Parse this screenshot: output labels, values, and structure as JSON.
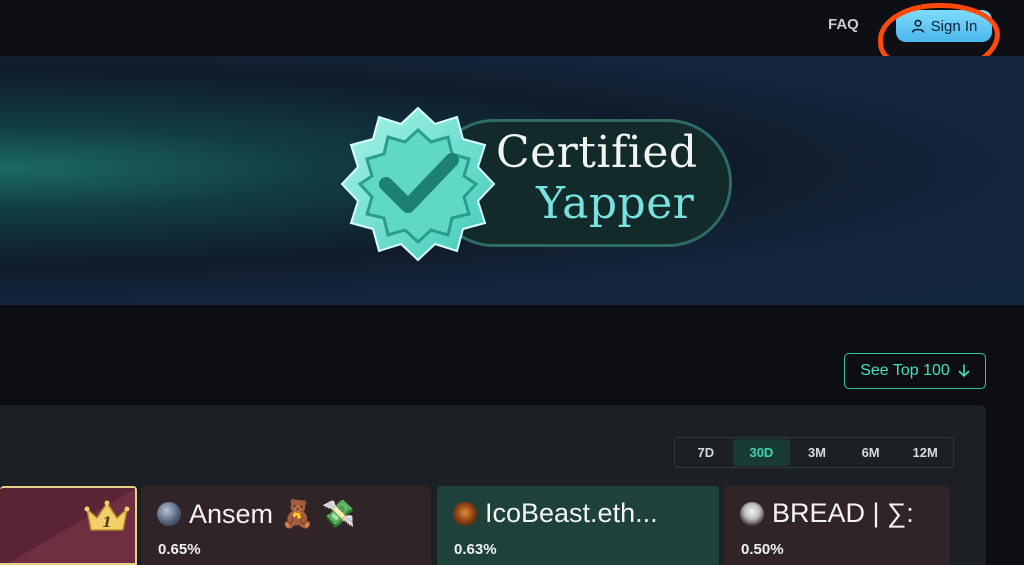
{
  "header": {
    "faq_label": "FAQ",
    "signin_label": "Sign In"
  },
  "hero": {
    "badge_line1": "Certified",
    "badge_line2": "Yapper"
  },
  "leaderboard": {
    "see_top_button": "See Top 100",
    "periods": [
      {
        "label": "7D",
        "active": false
      },
      {
        "label": "30D",
        "active": true
      },
      {
        "label": "3M",
        "active": false
      },
      {
        "label": "6M",
        "active": false
      },
      {
        "label": "12M",
        "active": false
      }
    ],
    "top_rank_badge": "1",
    "cards": [
      {
        "name": "Ansem 🧸 💸",
        "pct": "0.65%",
        "bg": "#302428"
      },
      {
        "name": "IcoBeast.eth...",
        "pct": "0.63%",
        "bg": "#1e4239"
      },
      {
        "name": "BREAD | ∑:",
        "pct": "0.50%",
        "bg": "#302428"
      }
    ]
  },
  "colors": {
    "accent": "#2fc6aa",
    "signin": "#5cc8f5",
    "annotation": "#ff4a0a"
  }
}
